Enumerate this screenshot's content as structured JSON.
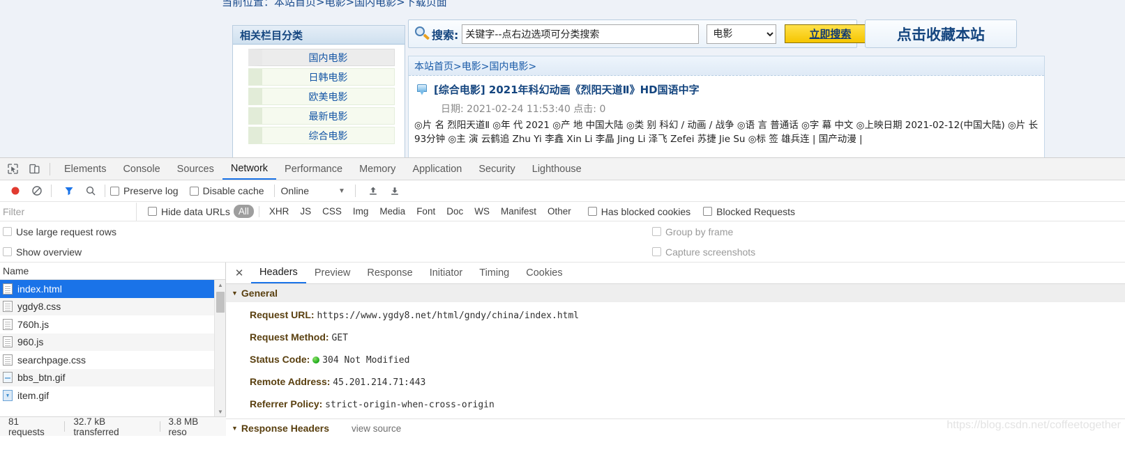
{
  "webpage": {
    "top_breadcrumb": "当前位置：本站首页>电影>国内电影>下载页面",
    "category_panel": {
      "title": "相关栏目分类",
      "items": [
        {
          "label": "国内电影",
          "active": true
        },
        {
          "label": "日韩电影",
          "active": false
        },
        {
          "label": "欧美电影",
          "active": false
        },
        {
          "label": "最新电影",
          "active": false
        },
        {
          "label": "综合电影",
          "active": false
        }
      ]
    },
    "search": {
      "icon": "magnifier-icon",
      "label": "搜索:",
      "input_value": "关键字--点右边选项可分类搜索",
      "select_value": "电影",
      "submit_label": "立即搜索"
    },
    "favorite_button": "点击收藏本站",
    "content": {
      "breadcrumb": "本站首页>电影>国内电影>",
      "movie_title": "[综合电影] 2021年科幻动画《烈阳天道Ⅱ》HD国语中字",
      "movie_meta": "日期: 2021-02-24 11:53:40 点击: 0",
      "movie_desc": "◎片 名 烈阳天道Ⅱ ◎年 代 2021 ◎产 地 中国大陆 ◎类 别 科幻 / 动画 / 战争 ◎语 言 普通话 ◎字 幕 中文 ◎上映日期 2021-02-12(中国大陆) ◎片 长 93分钟 ◎主 演 云鹤追 Zhu Yi 李鑫 Xin Li 李晶 Jing Li 泽飞 Zefei 苏捷 Jie Su ◎标 签 雄兵连 | 国产动漫 |"
    }
  },
  "devtools": {
    "icons": {
      "inspect": "inspect-element-icon",
      "device": "device-toolbar-icon"
    },
    "tabs": [
      {
        "label": "Elements",
        "selected": false
      },
      {
        "label": "Console",
        "selected": false
      },
      {
        "label": "Sources",
        "selected": false
      },
      {
        "label": "Network",
        "selected": true
      },
      {
        "label": "Performance",
        "selected": false
      },
      {
        "label": "Memory",
        "selected": false
      },
      {
        "label": "Application",
        "selected": false
      },
      {
        "label": "Security",
        "selected": false
      },
      {
        "label": "Lighthouse",
        "selected": false
      }
    ],
    "network_toolbar": {
      "record_icon": "record-button-icon",
      "clear_icon": "clear-icon",
      "filter_icon": "filter-funnel-icon",
      "search_icon": "search-icon",
      "preserve_log": "Preserve log",
      "disable_cache": "Disable cache",
      "throttling": "Online",
      "import_icon": "import-har-icon",
      "export_icon": "export-har-icon"
    },
    "filter_row": {
      "filter_placeholder": "Filter",
      "hide_data_urls": "Hide data URLs",
      "types": [
        {
          "label": "All",
          "selected": true
        },
        {
          "label": "XHR",
          "selected": false
        },
        {
          "label": "JS",
          "selected": false
        },
        {
          "label": "CSS",
          "selected": false
        },
        {
          "label": "Img",
          "selected": false
        },
        {
          "label": "Media",
          "selected": false
        },
        {
          "label": "Font",
          "selected": false
        },
        {
          "label": "Doc",
          "selected": false
        },
        {
          "label": "WS",
          "selected": false
        },
        {
          "label": "Manifest",
          "selected": false
        },
        {
          "label": "Other",
          "selected": false
        }
      ],
      "has_blocked_cookies": "Has blocked cookies",
      "blocked_requests": "Blocked Requests"
    },
    "options": {
      "use_large_request_rows": "Use large request rows",
      "group_by_frame": "Group by frame",
      "show_overview": "Show overview",
      "capture_screenshots": "Capture screenshots"
    },
    "request_list": {
      "column_header": "Name",
      "rows": [
        {
          "name": "index.html",
          "icon": "doc-icon",
          "selected": true
        },
        {
          "name": "ygdy8.css",
          "icon": "doc-icon",
          "selected": false
        },
        {
          "name": "760h.js",
          "icon": "doc-icon",
          "selected": false
        },
        {
          "name": "960.js",
          "icon": "doc-icon",
          "selected": false
        },
        {
          "name": "searchpage.css",
          "icon": "doc-icon",
          "selected": false
        },
        {
          "name": "bbs_btn.gif",
          "icon": "image-icon",
          "selected": false
        },
        {
          "name": "item.gif",
          "icon": "image-blue-icon",
          "selected": false
        }
      ]
    },
    "status_bar": {
      "requests": "81 requests",
      "transferred": "32.7 kB transferred",
      "resources": "3.8 MB reso"
    },
    "details": {
      "close_icon": "close-icon",
      "tabs": [
        {
          "label": "Headers",
          "selected": true
        },
        {
          "label": "Preview",
          "selected": false
        },
        {
          "label": "Response",
          "selected": false
        },
        {
          "label": "Initiator",
          "selected": false
        },
        {
          "label": "Timing",
          "selected": false
        },
        {
          "label": "Cookies",
          "selected": false
        }
      ],
      "general_title": "General",
      "general": [
        {
          "key": "Request URL:",
          "value": "https://www.ygdy8.net/html/gndy/china/index.html"
        },
        {
          "key": "Request Method:",
          "value": "GET"
        },
        {
          "key": "Status Code:",
          "value": "304 Not Modified",
          "dot": true
        },
        {
          "key": "Remote Address:",
          "value": "45.201.214.71:443"
        },
        {
          "key": "Referrer Policy:",
          "value": "strict-origin-when-cross-origin"
        }
      ],
      "response_headers_title": "Response Headers",
      "view_source": "view source"
    }
  },
  "watermark": "https://blog.csdn.net/coffeetogether"
}
